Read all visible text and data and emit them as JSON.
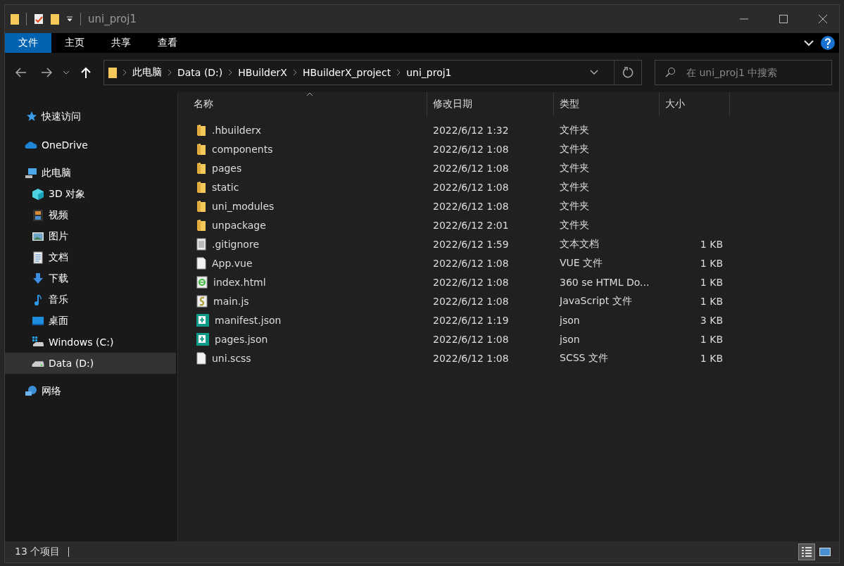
{
  "window": {
    "title": "uni_proj1"
  },
  "ribbon": {
    "tabs": [
      {
        "label": "文件",
        "selected": true
      },
      {
        "label": "主页",
        "selected": false
      },
      {
        "label": "共享",
        "selected": false
      },
      {
        "label": "查看",
        "selected": false
      }
    ]
  },
  "address_bar": {
    "crumbs": [
      "此电脑",
      "Data (D:)",
      "HBuilderX",
      "HBuilderX_project",
      "uni_proj1"
    ]
  },
  "search": {
    "placeholder": "在 uni_proj1 中搜索"
  },
  "sidebar": {
    "items": [
      {
        "label": "快速访问",
        "kind": "star",
        "selected": false
      },
      {
        "label": "OneDrive",
        "kind": "cloud",
        "selected": false
      },
      {
        "label": "此电脑",
        "kind": "pc",
        "selected": false,
        "children": [
          {
            "label": "3D 对象",
            "kind": "cube",
            "selected": false
          },
          {
            "label": "视频",
            "kind": "video",
            "selected": false
          },
          {
            "label": "图片",
            "kind": "image",
            "selected": false
          },
          {
            "label": "文档",
            "kind": "doc",
            "selected": false
          },
          {
            "label": "下载",
            "kind": "download",
            "selected": false
          },
          {
            "label": "音乐",
            "kind": "music",
            "selected": false
          },
          {
            "label": "桌面",
            "kind": "desktop",
            "selected": false
          },
          {
            "label": "Windows (C:)",
            "kind": "windrive",
            "selected": false
          },
          {
            "label": "Data (D:)",
            "kind": "drive",
            "selected": true
          }
        ]
      },
      {
        "label": "网络",
        "kind": "network",
        "selected": false
      }
    ]
  },
  "table": {
    "columns": [
      "名称",
      "修改日期",
      "类型",
      "大小"
    ],
    "rows": [
      {
        "name": ".hbuilderx",
        "date": "2022/6/12 1:32",
        "type": "文件夹",
        "kind": "folder"
      },
      {
        "name": "components",
        "date": "2022/6/12 1:08",
        "type": "文件夹",
        "kind": "folder"
      },
      {
        "name": "pages",
        "date": "2022/6/12 1:08",
        "type": "文件夹",
        "kind": "folder"
      },
      {
        "name": "static",
        "date": "2022/6/12 1:08",
        "type": "文件夹",
        "kind": "folder"
      },
      {
        "name": "uni_modules",
        "date": "2022/6/12 1:08",
        "type": "文件夹",
        "kind": "folder"
      },
      {
        "name": "unpackage",
        "date": "2022/6/12 2:01",
        "type": "文件夹",
        "kind": "folder"
      },
      {
        "name": ".gitignore",
        "date": "2022/6/12 1:59",
        "type": "文本文档",
        "size": "1 KB",
        "kind": "text"
      },
      {
        "name": "App.vue",
        "date": "2022/6/12 1:08",
        "type": "VUE 文件",
        "size": "1 KB",
        "kind": "blank"
      },
      {
        "name": "index.html",
        "date": "2022/6/12 1:08",
        "type": "360 se HTML Do...",
        "size": "1 KB",
        "kind": "html"
      },
      {
        "name": "main.js",
        "date": "2022/6/12 1:08",
        "type": "JavaScript 文件",
        "size": "1 KB",
        "kind": "script"
      },
      {
        "name": "manifest.json",
        "date": "2022/6/12 1:19",
        "type": "json",
        "size": "3 KB",
        "kind": "json"
      },
      {
        "name": "pages.json",
        "date": "2022/6/12 1:08",
        "type": "json",
        "size": "1 KB",
        "kind": "json"
      },
      {
        "name": "uni.scss",
        "date": "2022/6/12 1:08",
        "type": "SCSS 文件",
        "size": "1 KB",
        "kind": "blank"
      }
    ]
  },
  "status_bar": {
    "count": "13 个项目",
    "views": [
      {
        "kind": "details",
        "selected": true
      },
      {
        "kind": "tiles",
        "selected": false
      }
    ]
  }
}
